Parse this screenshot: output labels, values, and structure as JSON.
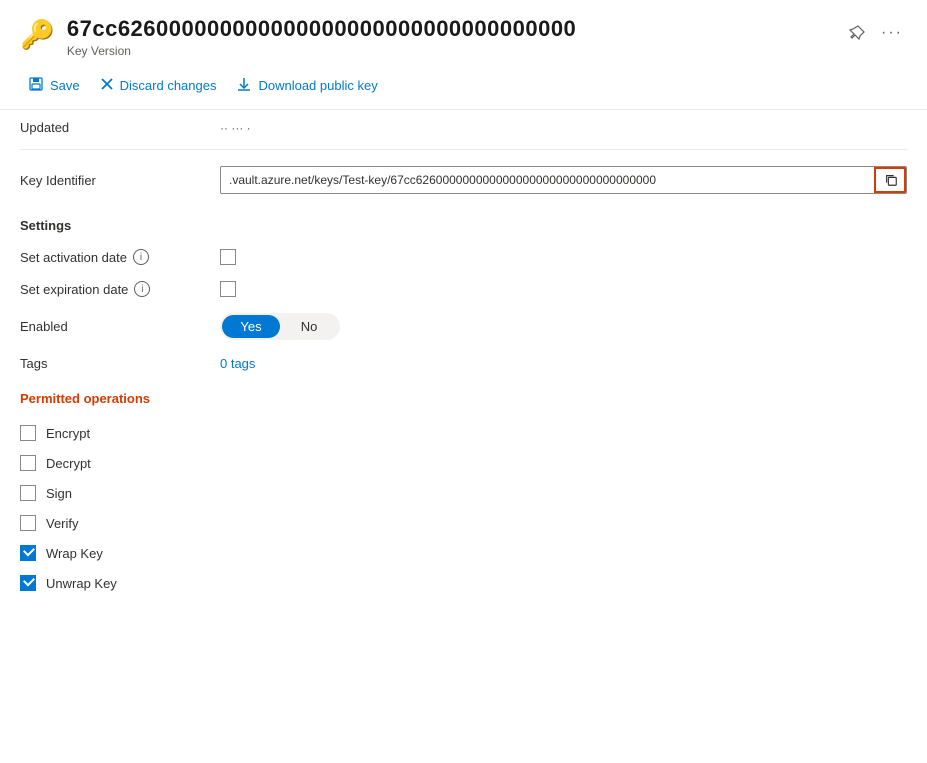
{
  "header": {
    "key_icon": "🔑",
    "title": "67cc626000000000000000000000000000000000",
    "subtitle": "Key Version",
    "pin_icon": "📌",
    "more_icon": "···"
  },
  "toolbar": {
    "save_label": "Save",
    "discard_label": "Discard changes",
    "download_label": "Download public key"
  },
  "scrolled_label": "Updated",
  "key_identifier": {
    "label": "Key Identifier",
    "value": ".vault.azure.net/keys/Test-key/67cc626000000000000000000000000000000000",
    "copy_icon": "⧉"
  },
  "settings": {
    "section_title": "Settings",
    "activation": {
      "label": "Set activation date",
      "checked": false
    },
    "expiration": {
      "label": "Set expiration date",
      "checked": false
    },
    "enabled": {
      "label": "Enabled",
      "yes_label": "Yes",
      "no_label": "No",
      "active": "yes"
    },
    "tags": {
      "label": "Tags",
      "value": "0 tags"
    }
  },
  "permitted_operations": {
    "section_title": "Permitted operations",
    "operations": [
      {
        "label": "Encrypt",
        "checked": false
      },
      {
        "label": "Decrypt",
        "checked": false
      },
      {
        "label": "Sign",
        "checked": false
      },
      {
        "label": "Verify",
        "checked": false
      },
      {
        "label": "Wrap Key",
        "checked": true
      },
      {
        "label": "Unwrap Key",
        "checked": true
      }
    ]
  }
}
